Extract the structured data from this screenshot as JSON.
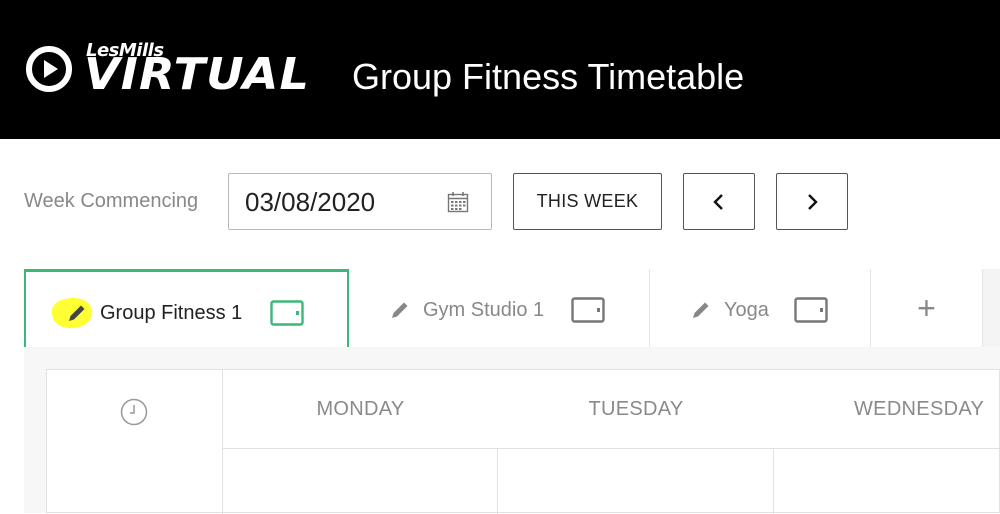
{
  "header": {
    "logo_top": "LesMills",
    "logo_main": "VIRTUAL",
    "title": "Group Fitness Timetable"
  },
  "toolbar": {
    "week_label": "Week Commencing",
    "date_value": "03/08/2020",
    "this_week_label": "THIS WEEK",
    "prev_icon": "chevron-left-icon",
    "next_icon": "chevron-right-icon"
  },
  "tabs": [
    {
      "label": "Group Fitness 1",
      "active": true
    },
    {
      "label": "Gym Studio 1",
      "active": false
    },
    {
      "label": "Yoga",
      "active": false
    }
  ],
  "add_tab_label": "+",
  "timetable": {
    "days": [
      "MONDAY",
      "TUESDAY",
      "WEDNESDAY"
    ]
  },
  "colors": {
    "header_bg": "#000000",
    "active_tab_accent": "#3bb877",
    "highlight": "#ffff33"
  }
}
